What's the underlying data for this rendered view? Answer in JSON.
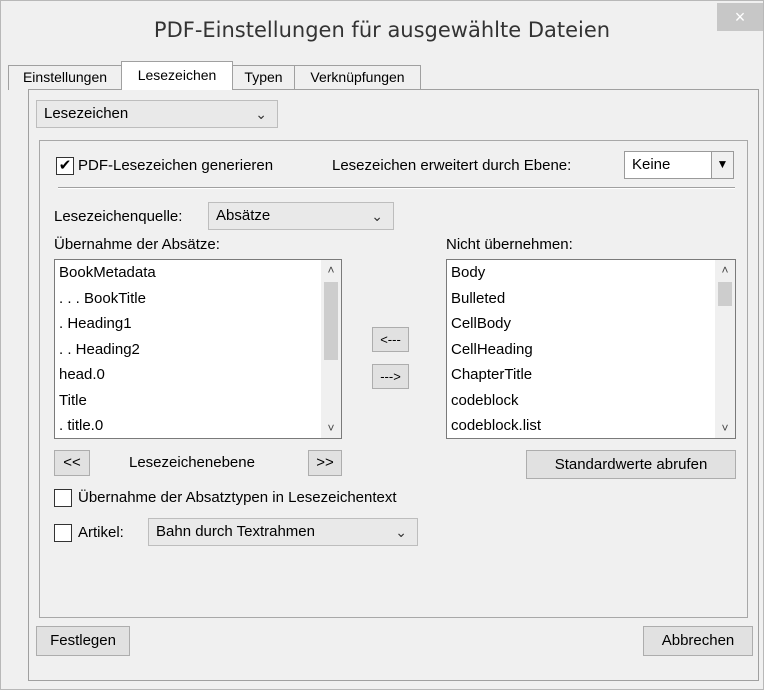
{
  "window": {
    "title": "PDF-Einstellungen für ausgewählte Dateien",
    "close_glyph": "×"
  },
  "tabs": [
    "Einstellungen",
    "Lesezeichen",
    "Typen",
    "Verknüpfungen"
  ],
  "active_tab": "Lesezeichen",
  "section_select": {
    "value": "Lesezeichen"
  },
  "generate": {
    "checked": true,
    "label": "PDF-Lesezeichen generieren",
    "expand_label": "Lesezeichen erweitert durch Ebene:",
    "expand_value": "Keine"
  },
  "source": {
    "label": "Lesezeichenquelle:",
    "value": "Absätze"
  },
  "include_list": {
    "label": "Übernahme der Absätze:",
    "items": [
      "BookMetadata",
      ". . . BookTitle",
      ". Heading1",
      ". . Heading2",
      "head.0",
      "Title",
      ". title.0"
    ]
  },
  "exclude_list": {
    "label": "Nicht übernehmen:",
    "items": [
      "Body",
      "Bulleted",
      "CellBody",
      "CellHeading",
      "ChapterTitle",
      "codeblock",
      "codeblock.list"
    ]
  },
  "move_buttons": {
    "left": "<---",
    "right": "--->"
  },
  "level": {
    "decrease": "<<",
    "label": "Lesezeichenebene",
    "increase": ">>"
  },
  "defaults_button": "Standardwerte abrufen",
  "paragraph_types": {
    "checked": false,
    "label": "Übernahme der Absatztypen in Lesezeichentext"
  },
  "article": {
    "checked": false,
    "label": "Artikel:",
    "value": "Bahn durch Textrahmen"
  },
  "footer": {
    "apply": "Festlegen",
    "cancel": "Abbrechen"
  },
  "colors": {
    "close_button_bg": "#c7c7c7",
    "dialog_bg": "#f0f0f0"
  }
}
